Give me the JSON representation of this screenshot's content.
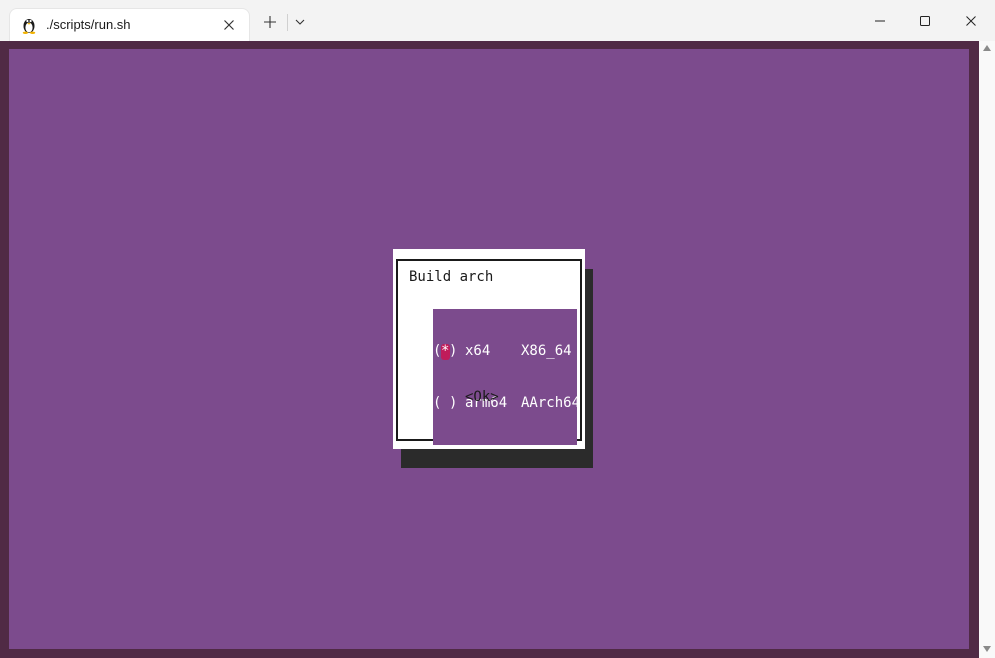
{
  "window": {
    "tab_title": "./scripts/run.sh",
    "tab_icon": "linux-penguin-icon"
  },
  "dialog": {
    "title": "Build arch",
    "options": [
      {
        "mark_open": "(",
        "mark_star": "*",
        "mark_close": ")",
        "name": "x64",
        "description": "X86_64",
        "selected": true
      },
      {
        "mark_open": "(",
        "mark_star": " ",
        "mark_close": ")",
        "name": "arm64",
        "description": "AArch64",
        "selected": false
      }
    ],
    "ok_label": "<Ok>"
  },
  "colors": {
    "terminal_background": "#7c4b8d",
    "terminal_frame": "#502a45",
    "cursor": "#c01c5a",
    "dialog_shadow": "#2b2b2b"
  }
}
